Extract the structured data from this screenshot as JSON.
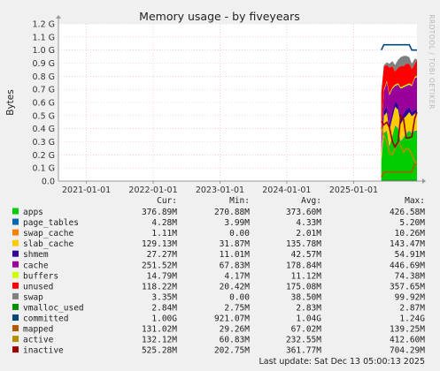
{
  "chart_data": {
    "type": "area",
    "title": "Memory usage - by fiveyears",
    "ylabel": "Bytes",
    "side_label": "RRDTOOL / TOBI OETIKER",
    "x_ticks": [
      "2021-01-01",
      "2022-01-01",
      "2023-01-01",
      "2024-01-01",
      "2025-01-01"
    ],
    "xlim": [
      "2020-08-01",
      "2025-12-13"
    ],
    "y_ticks": [
      "0.0",
      "0.1 G",
      "0.2 G",
      "0.3 G",
      "0.4 G",
      "0.5 G",
      "0.6 G",
      "0.7 G",
      "0.8 G",
      "0.9 G",
      "1.0 G",
      "1.1 G",
      "1.2 G"
    ],
    "ylim": [
      0,
      1.2
    ],
    "y_unit": "G",
    "grid": true,
    "columns": [
      "Cur:",
      "Min:",
      "Avg:",
      "Max:"
    ],
    "legend_position": "bottom",
    "x": [
      "2025-06-01",
      "2025-06-15",
      "2025-07-01",
      "2025-07-15",
      "2025-08-01",
      "2025-08-15",
      "2025-09-01",
      "2025-09-15",
      "2025-10-01",
      "2025-10-15",
      "2025-11-01",
      "2025-11-15",
      "2025-12-01",
      "2025-12-13"
    ],
    "series": [
      {
        "name": "apps",
        "color": "#00cc00",
        "stacked": true,
        "values": [
          0.15,
          0.36,
          0.38,
          0.26,
          0.34,
          0.42,
          0.4,
          0.3,
          0.33,
          0.36,
          0.38,
          0.36,
          0.38,
          0.38
        ],
        "cur": "376.89M",
        "min": "270.88M",
        "avg": "373.60M",
        "max": "426.58M"
      },
      {
        "name": "page_tables",
        "color": "#0066b3",
        "stacked": true,
        "values": [
          0.004,
          0.004,
          0.004,
          0.004,
          0.004,
          0.004,
          0.004,
          0.004,
          0.004,
          0.004,
          0.004,
          0.004,
          0.004,
          0.004
        ],
        "cur": "4.28M",
        "min": "3.99M",
        "avg": "4.33M",
        "max": "5.20M"
      },
      {
        "name": "swap_cache",
        "color": "#ff8000",
        "stacked": true,
        "values": [
          0.002,
          0.002,
          0.002,
          0.002,
          0.002,
          0.002,
          0.002,
          0.002,
          0.002,
          0.002,
          0.002,
          0.001,
          0.001,
          0.001
        ],
        "cur": "1.11M",
        "min": "0.00",
        "avg": "2.01M",
        "max": "10.26M"
      },
      {
        "name": "slab_cache",
        "color": "#ffcc00",
        "stacked": true,
        "values": [
          0.05,
          0.13,
          0.14,
          0.12,
          0.14,
          0.14,
          0.14,
          0.13,
          0.14,
          0.13,
          0.14,
          0.13,
          0.13,
          0.13
        ],
        "cur": "129.13M",
        "min": "31.87M",
        "avg": "135.78M",
        "max": "143.47M"
      },
      {
        "name": "shmem",
        "color": "#330099",
        "stacked": true,
        "values": [
          0.03,
          0.04,
          0.05,
          0.04,
          0.05,
          0.04,
          0.04,
          0.05,
          0.04,
          0.05,
          0.04,
          0.03,
          0.03,
          0.03
        ],
        "cur": "27.27M",
        "min": "11.01M",
        "avg": "42.57M",
        "max": "54.91M"
      },
      {
        "name": "cache",
        "color": "#990099",
        "stacked": true,
        "values": [
          0.07,
          0.15,
          0.18,
          0.23,
          0.17,
          0.12,
          0.15,
          0.22,
          0.2,
          0.18,
          0.17,
          0.2,
          0.24,
          0.25
        ],
        "cur": "251.52M",
        "min": "67.83M",
        "avg": "178.84M",
        "max": "446.69M"
      },
      {
        "name": "buffers",
        "color": "#ccff00",
        "stacked": true,
        "values": [
          0.01,
          0.01,
          0.01,
          0.01,
          0.01,
          0.01,
          0.01,
          0.01,
          0.01,
          0.01,
          0.01,
          0.01,
          0.01,
          0.01
        ],
        "cur": "14.79M",
        "min": "4.17M",
        "avg": "11.12M",
        "max": "74.38M"
      },
      {
        "name": "unused",
        "color": "#ff0000",
        "stacked": true,
        "values": [
          0.36,
          0.18,
          0.12,
          0.2,
          0.16,
          0.1,
          0.12,
          0.16,
          0.15,
          0.16,
          0.15,
          0.12,
          0.1,
          0.12
        ],
        "cur": "118.22M",
        "min": "20.42M",
        "avg": "175.08M",
        "max": "357.65M"
      },
      {
        "name": "swap",
        "color": "#808080",
        "stacked": true,
        "values": [
          0.01,
          0.01,
          0.02,
          0.03,
          0.04,
          0.05,
          0.06,
          0.07,
          0.08,
          0.06,
          0.05,
          0.04,
          0.04,
          0.003
        ],
        "cur": "3.35M",
        "min": "0.00",
        "avg": "38.50M",
        "max": "99.92M"
      },
      {
        "name": "vmalloc_used",
        "color": "#008f00",
        "stacked": false,
        "values": [
          0.003,
          0.003,
          0.003,
          0.003,
          0.003,
          0.003,
          0.003,
          0.003,
          0.003,
          0.003,
          0.003,
          0.003,
          0.003,
          0.003
        ],
        "cur": "2.84M",
        "min": "2.75M",
        "avg": "2.83M",
        "max": "2.87M"
      },
      {
        "name": "committed",
        "color": "#00487d",
        "stacked": false,
        "values": [
          1.0,
          1.04,
          1.04,
          1.04,
          1.04,
          1.04,
          1.04,
          1.04,
          1.04,
          1.04,
          1.04,
          1.0,
          1.0,
          1.0
        ],
        "cur": "1.00G",
        "min": "921.07M",
        "avg": "1.04G",
        "max": "1.24G"
      },
      {
        "name": "mapped",
        "color": "#b35a00",
        "stacked": false,
        "values": [
          0.03,
          0.07,
          0.07,
          0.07,
          0.07,
          0.07,
          0.07,
          0.07,
          0.07,
          0.07,
          0.07,
          0.07,
          0.13,
          0.13
        ],
        "cur": "131.02M",
        "min": "29.26M",
        "avg": "67.02M",
        "max": "139.25M"
      },
      {
        "name": "active",
        "color": "#b38f00",
        "stacked": false,
        "values": [
          0.41,
          0.35,
          0.3,
          0.22,
          0.2,
          0.25,
          0.3,
          0.27,
          0.22,
          0.25,
          0.24,
          0.2,
          0.15,
          0.13
        ],
        "cur": "132.12M",
        "min": "60.83M",
        "avg": "232.55M",
        "max": "412.60M"
      },
      {
        "name": "inactive",
        "color": "#990000",
        "stacked": false,
        "values": [
          0.46,
          0.43,
          0.45,
          0.41,
          0.3,
          0.26,
          0.3,
          0.5,
          0.47,
          0.33,
          0.33,
          0.34,
          0.48,
          0.525
        ],
        "cur": "525.28M",
        "min": "202.75M",
        "avg": "361.77M",
        "max": "704.29M"
      }
    ],
    "footer": "Last update: Sat Dec 13 05:00:13 2025"
  }
}
